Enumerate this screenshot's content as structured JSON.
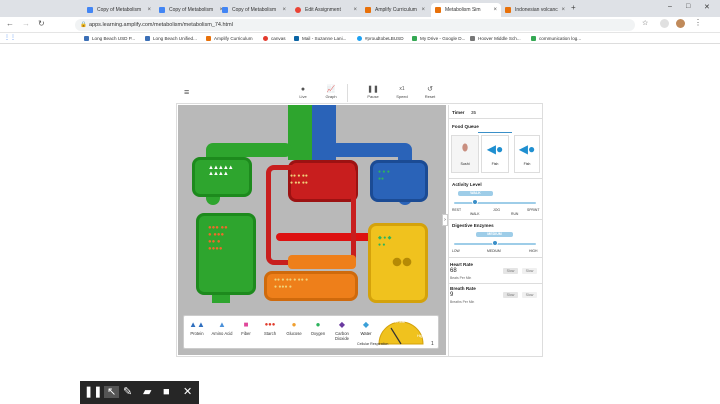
{
  "tabs": [
    {
      "label": "Copy of Metabolism",
      "color": "#4285f4"
    },
    {
      "label": "Copy of Metabolism",
      "color": "#4285f4"
    },
    {
      "label": "Copy of Metabolism",
      "color": "#4285f4"
    },
    {
      "label": "Edit Assignment",
      "color": "#ea4335"
    },
    {
      "label": "Amplify Curriculum",
      "color": "#e8710a"
    },
    {
      "label": "Metabolism Sim",
      "color": "#e8710a"
    },
    {
      "label": "Indonesian volcanc",
      "color": "#e8710a"
    }
  ],
  "url": "apps.learning.amplify.com/metabolism/metabolism_74.html",
  "bookmarks": [
    {
      "label": "Long Beach USD P...",
      "color": "#3b6fb6"
    },
    {
      "label": "Long Beach Unified...",
      "color": "#3b6fb6"
    },
    {
      "label": "Amplify Curriculum",
      "color": "#e8710a"
    },
    {
      "label": "canvas",
      "color": "#e33b2e"
    },
    {
      "label": "Mail - Suzanne Lani...",
      "color": "#0a64a4"
    },
    {
      "label": "#proudtobeLBUSD",
      "color": "#1da1f2"
    },
    {
      "label": "My Drive - Google D...",
      "color": "#34a853"
    },
    {
      "label": "Hoover Middle Sch...",
      "color": "#777777"
    },
    {
      "label": "communication log...",
      "color": "#34a853"
    }
  ],
  "toolbar": {
    "live": "Live",
    "graph": "Graph",
    "pause": "Pause",
    "speed_value": "x1",
    "speed": "Speed",
    "reset": "Reset"
  },
  "legend": [
    {
      "label": "Protein",
      "glyph": "▲▲",
      "color": "#2f6fbf"
    },
    {
      "label": "Amino Acid",
      "glyph": "▲",
      "color": "#4a90d9"
    },
    {
      "label": "Fiber",
      "glyph": "■",
      "color": "#e0479a"
    },
    {
      "label": "Starch",
      "glyph": "●●●",
      "color": "#e03a2a"
    },
    {
      "label": "Glucose",
      "glyph": "●",
      "color": "#f0a030"
    },
    {
      "label": "Oxygen",
      "glyph": "●",
      "color": "#2db35d"
    },
    {
      "label": "Carbon Dioxide",
      "glyph": "◆",
      "color": "#6a3aa0"
    },
    {
      "label": "Water",
      "glyph": "◆",
      "color": "#3aa0d8"
    }
  ],
  "gauge": {
    "top": "Aerobic",
    "left": "Anaerobic",
    "right": "High",
    "label": "Cellular Respiration",
    "value": "1"
  },
  "panel": {
    "timer_label": "Timer",
    "timer_value": "35",
    "food_queue": "Food Queue",
    "food_items": [
      "Sushi",
      "Fish",
      "Fish"
    ],
    "activity_level": "Activity Level",
    "activity_value": "WALK",
    "activity_ticks": [
      "REST",
      "WALK",
      "JOG",
      "RUN",
      "SPRINT"
    ],
    "activity_level_value": 0.25,
    "digestive_enzymes": "Digestive Enzymes",
    "enzyme_value": "MEDIUM",
    "enzyme_ticks": [
      "LOW",
      "MEDIUM",
      "HIGH"
    ],
    "enzyme_level_value": 0.5,
    "heart_rate": "Heart Rate",
    "heart_value": "68",
    "heart_unit": "Beats Per Min",
    "breath_rate": "Breath Rate",
    "breath_value": "9",
    "breath_unit": "Breaths Per Min",
    "slow": "Slow",
    "fast": "Slow"
  }
}
